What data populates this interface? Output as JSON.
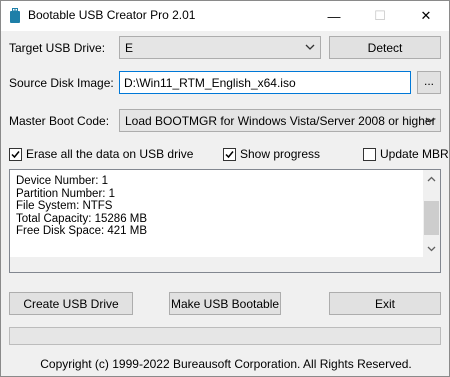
{
  "window": {
    "title": "Bootable USB Creator Pro 2.01",
    "minimize_glyph": "—",
    "maximize_glyph": "☐",
    "close_glyph": "✕"
  },
  "target": {
    "label": "Target USB Drive:",
    "value": "E",
    "detect_label": "Detect"
  },
  "source": {
    "label": "Source Disk Image:",
    "value": "D:\\Win11_RTM_English_x64.iso",
    "browse_label": "..."
  },
  "boot": {
    "label": "Master Boot Code:",
    "value": "Load BOOTMGR for Windows Vista/Server 2008 or higher"
  },
  "options": {
    "erase": {
      "label": "Erase all the data on USB drive",
      "checked": true
    },
    "progress": {
      "label": "Show progress",
      "checked": true
    },
    "update_mbr": {
      "label": "Update MBR",
      "checked": false
    }
  },
  "info": {
    "lines": [
      "Device Number: 1",
      "Partition Number: 1",
      "File System: NTFS",
      "Total Capacity: 15286 MB",
      "Free Disk Space: 421 MB"
    ]
  },
  "actions": {
    "create_label": "Create USB Drive",
    "bootable_label": "Make USB Bootable",
    "exit_label": "Exit"
  },
  "progress": {
    "value": 0
  },
  "footer": {
    "copyright": "Copyright (c) 1999-2022 Bureausoft Corporation. All Rights Reserved."
  },
  "colors": {
    "accent": "#0078d7",
    "progress_fill": "#06b025",
    "app_icon": "#1e7fa8"
  }
}
